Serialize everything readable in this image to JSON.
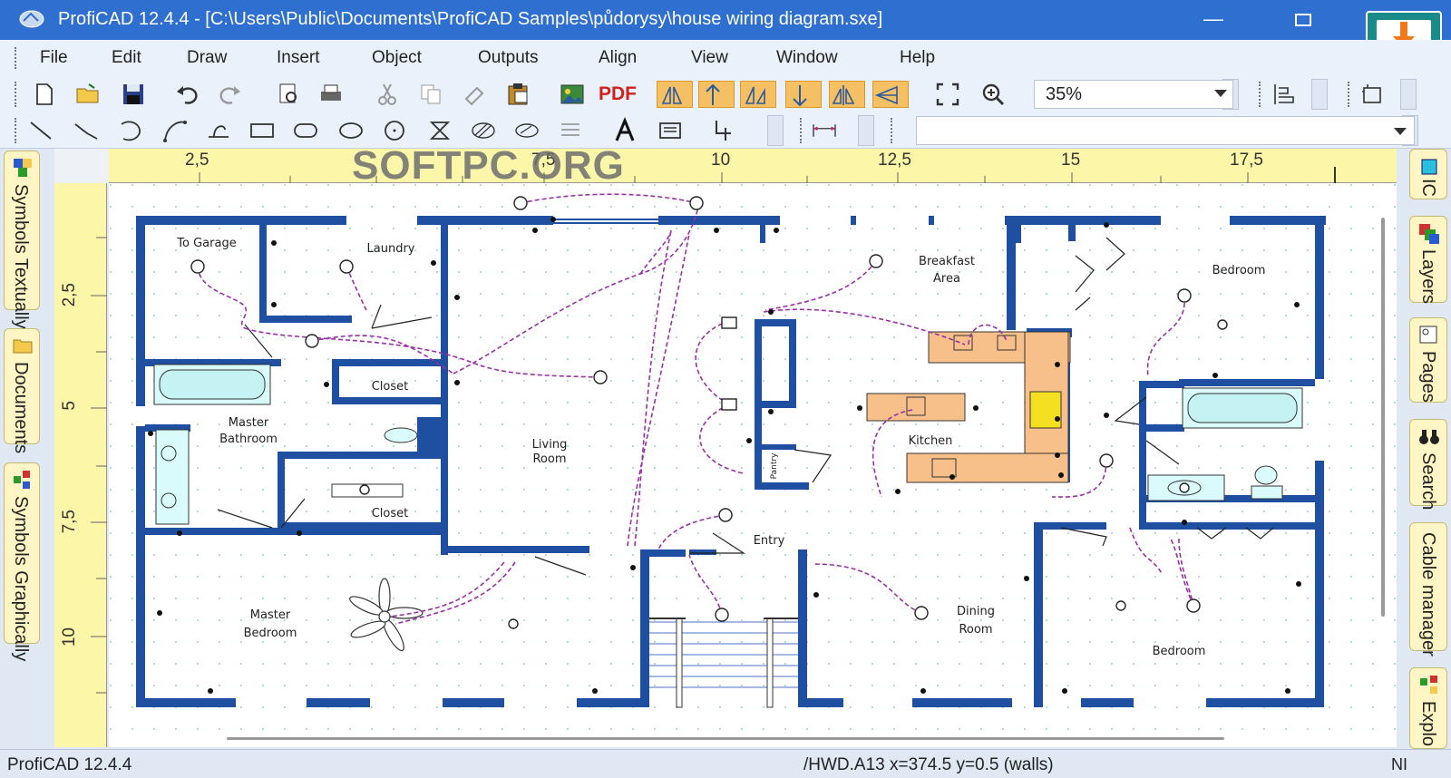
{
  "window": {
    "title": "ProfiCAD 12.4.4 - [C:\\Users\\Public\\Documents\\ProfiCAD Samples\\půdorysy\\house wiring diagram.sxe]",
    "minimize_glyph": "—"
  },
  "menu": [
    "File",
    "Edit",
    "Draw",
    "Insert",
    "Object",
    "Outputs",
    "Align",
    "View",
    "Window",
    "Help"
  ],
  "toolbar": {
    "zoom": "35%",
    "pdf_label": "PDF"
  },
  "watermark": "SOFTPC.ORG",
  "rulers": {
    "top": [
      "2,5",
      "7,5",
      "10",
      "12,5",
      "15",
      "17,5"
    ],
    "left": [
      "2,5",
      "5",
      "7,5",
      "10"
    ]
  },
  "left_tabs": [
    "Symbols Textually",
    "Documents",
    "Symbols Graphically"
  ],
  "right_tabs": [
    "IC",
    "Layers",
    "Pages",
    "Search",
    "Cable manager",
    "Explo"
  ],
  "rooms": {
    "to_garage": "To Garage",
    "laundry": "Laundry",
    "breakfast_1": "Breakfast",
    "breakfast_2": "Area",
    "bedroom_ne": "Bedroom",
    "closet_1": "Closet",
    "master_bath_1": "Master",
    "master_bath_2": "Bathroom",
    "living_1": "Living",
    "living_2": "Room",
    "kitchen": "Kitchen",
    "closet_2": "Closet",
    "entry": "Entry",
    "dining_1": "Dining",
    "dining_2": "Room",
    "master_bed_1": "Master",
    "master_bed_2": "Bedroom",
    "bedroom_se": "Bedroom",
    "pantry": "Pantry"
  },
  "status": {
    "left": "ProfiCAD 12.4.4",
    "coords": "/HWD.A13  x=374.5  y=0.5 (walls)",
    "right": "NI"
  },
  "colors": {
    "titlebar": "#2f6fd0",
    "wall": "#1f4fa0",
    "wiring": "#9b2ea8",
    "ruler": "#fbf6a8",
    "kitchen_counter": "#f7c08a"
  }
}
